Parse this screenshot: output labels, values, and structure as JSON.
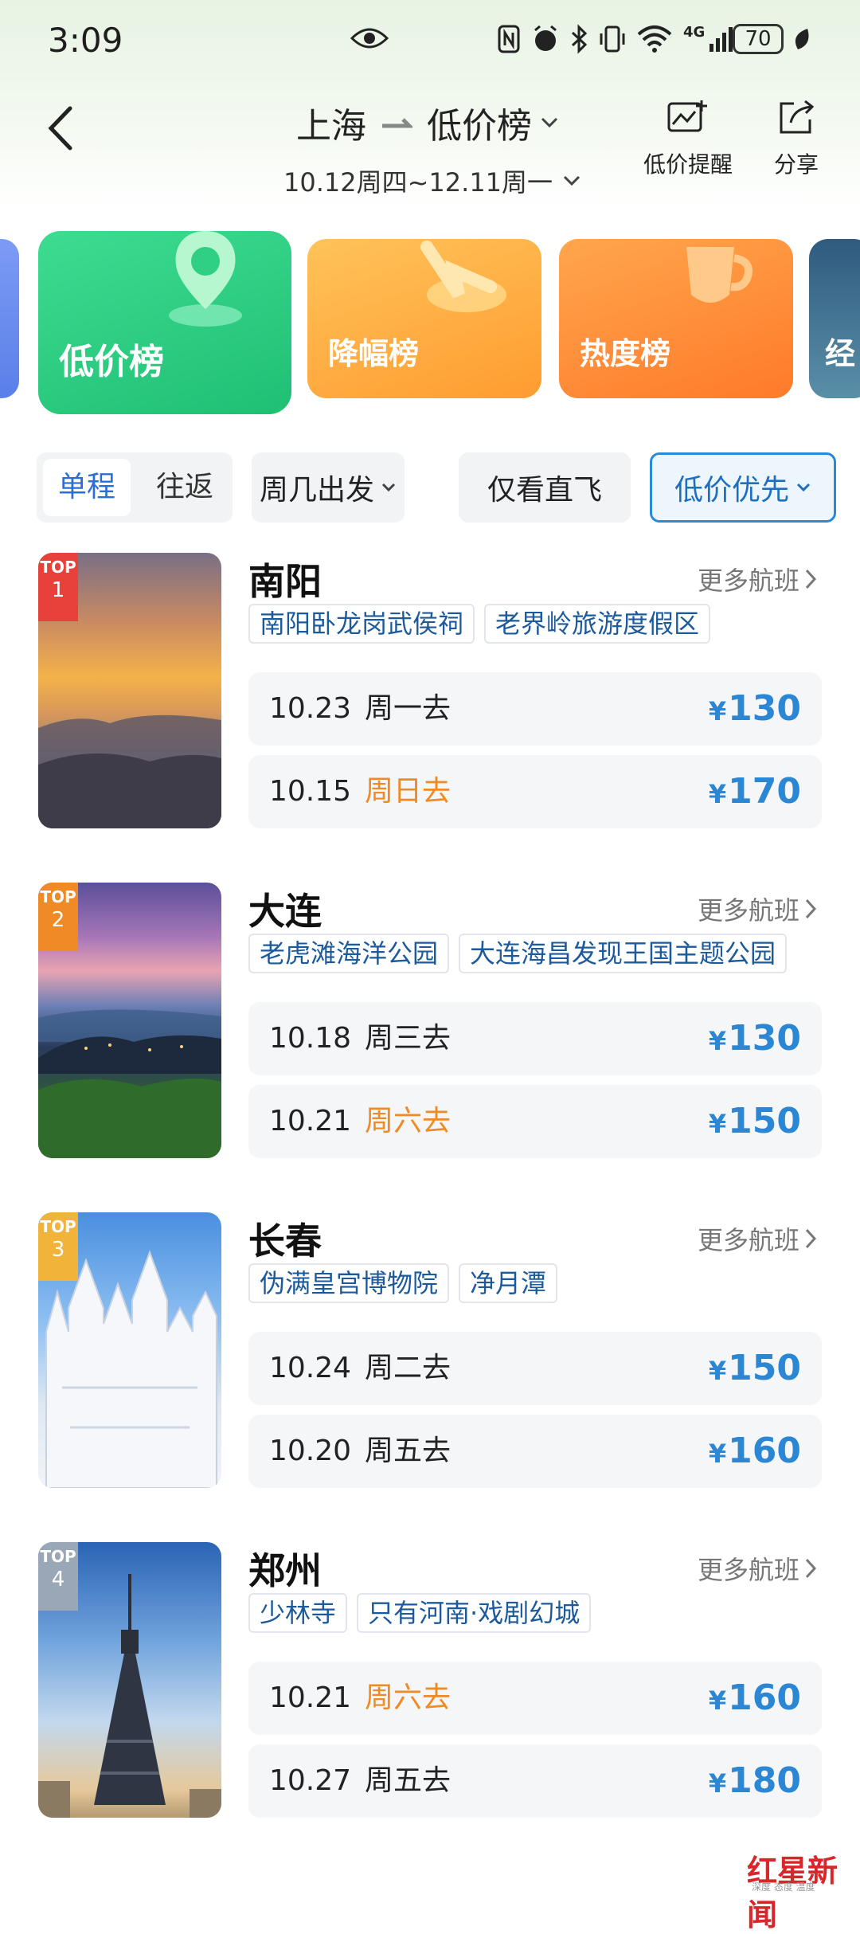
{
  "status": {
    "time": "3:09",
    "network": "4G",
    "battery": "70"
  },
  "header": {
    "origin": "上海",
    "destination": "低价榜",
    "dates": "10.12周四~12.11周一",
    "alert_label": "低价提醒",
    "share_label": "分享"
  },
  "categories": [
    {
      "label": "低价榜"
    },
    {
      "label": "降幅榜"
    },
    {
      "label": "热度榜"
    },
    {
      "label": "经"
    }
  ],
  "filters": {
    "oneway": "单程",
    "roundtrip": "往返",
    "weekday": "周几出发",
    "direct": "仅看直飞",
    "sort": "低价优先"
  },
  "more_label": "更多航班",
  "destinations": [
    {
      "badge_top": "TOP",
      "rank": "1",
      "city": "南阳",
      "tags": [
        "南阳卧龙岗武侯祠",
        "老界岭旅游度假区"
      ],
      "flights": [
        {
          "date": "10.23",
          "weekday": "周一去",
          "weekend": false,
          "currency": "¥",
          "price": "130"
        },
        {
          "date": "10.15",
          "weekday": "周日去",
          "weekend": true,
          "currency": "¥",
          "price": "170"
        }
      ]
    },
    {
      "badge_top": "TOP",
      "rank": "2",
      "city": "大连",
      "tags": [
        "老虎滩海洋公园",
        "大连海昌发现王国主题公园"
      ],
      "flights": [
        {
          "date": "10.18",
          "weekday": "周三去",
          "weekend": false,
          "currency": "¥",
          "price": "130"
        },
        {
          "date": "10.21",
          "weekday": "周六去",
          "weekend": true,
          "currency": "¥",
          "price": "150"
        }
      ]
    },
    {
      "badge_top": "TOP",
      "rank": "3",
      "city": "长春",
      "tags": [
        "伪满皇宫博物院",
        "净月潭"
      ],
      "flights": [
        {
          "date": "10.24",
          "weekday": "周二去",
          "weekend": false,
          "currency": "¥",
          "price": "150"
        },
        {
          "date": "10.20",
          "weekday": "周五去",
          "weekend": false,
          "currency": "¥",
          "price": "160"
        }
      ]
    },
    {
      "badge_top": "TOP",
      "rank": "4",
      "city": "郑州",
      "tags": [
        "少林寺",
        "只有河南·戏剧幻城"
      ],
      "flights": [
        {
          "date": "10.21",
          "weekday": "周六去",
          "weekend": true,
          "currency": "¥",
          "price": "160"
        },
        {
          "date": "10.27",
          "weekday": "周五去",
          "weekend": false,
          "currency": "¥",
          "price": "180"
        }
      ]
    }
  ],
  "watermark": {
    "brand": "红星新闻",
    "tagline": "深度 态度 温度"
  },
  "colors": {
    "price": "#2b86d4",
    "weekend": "#f08a24",
    "tag_text": "#1d5a9c",
    "accent": "#2b6fd6"
  }
}
